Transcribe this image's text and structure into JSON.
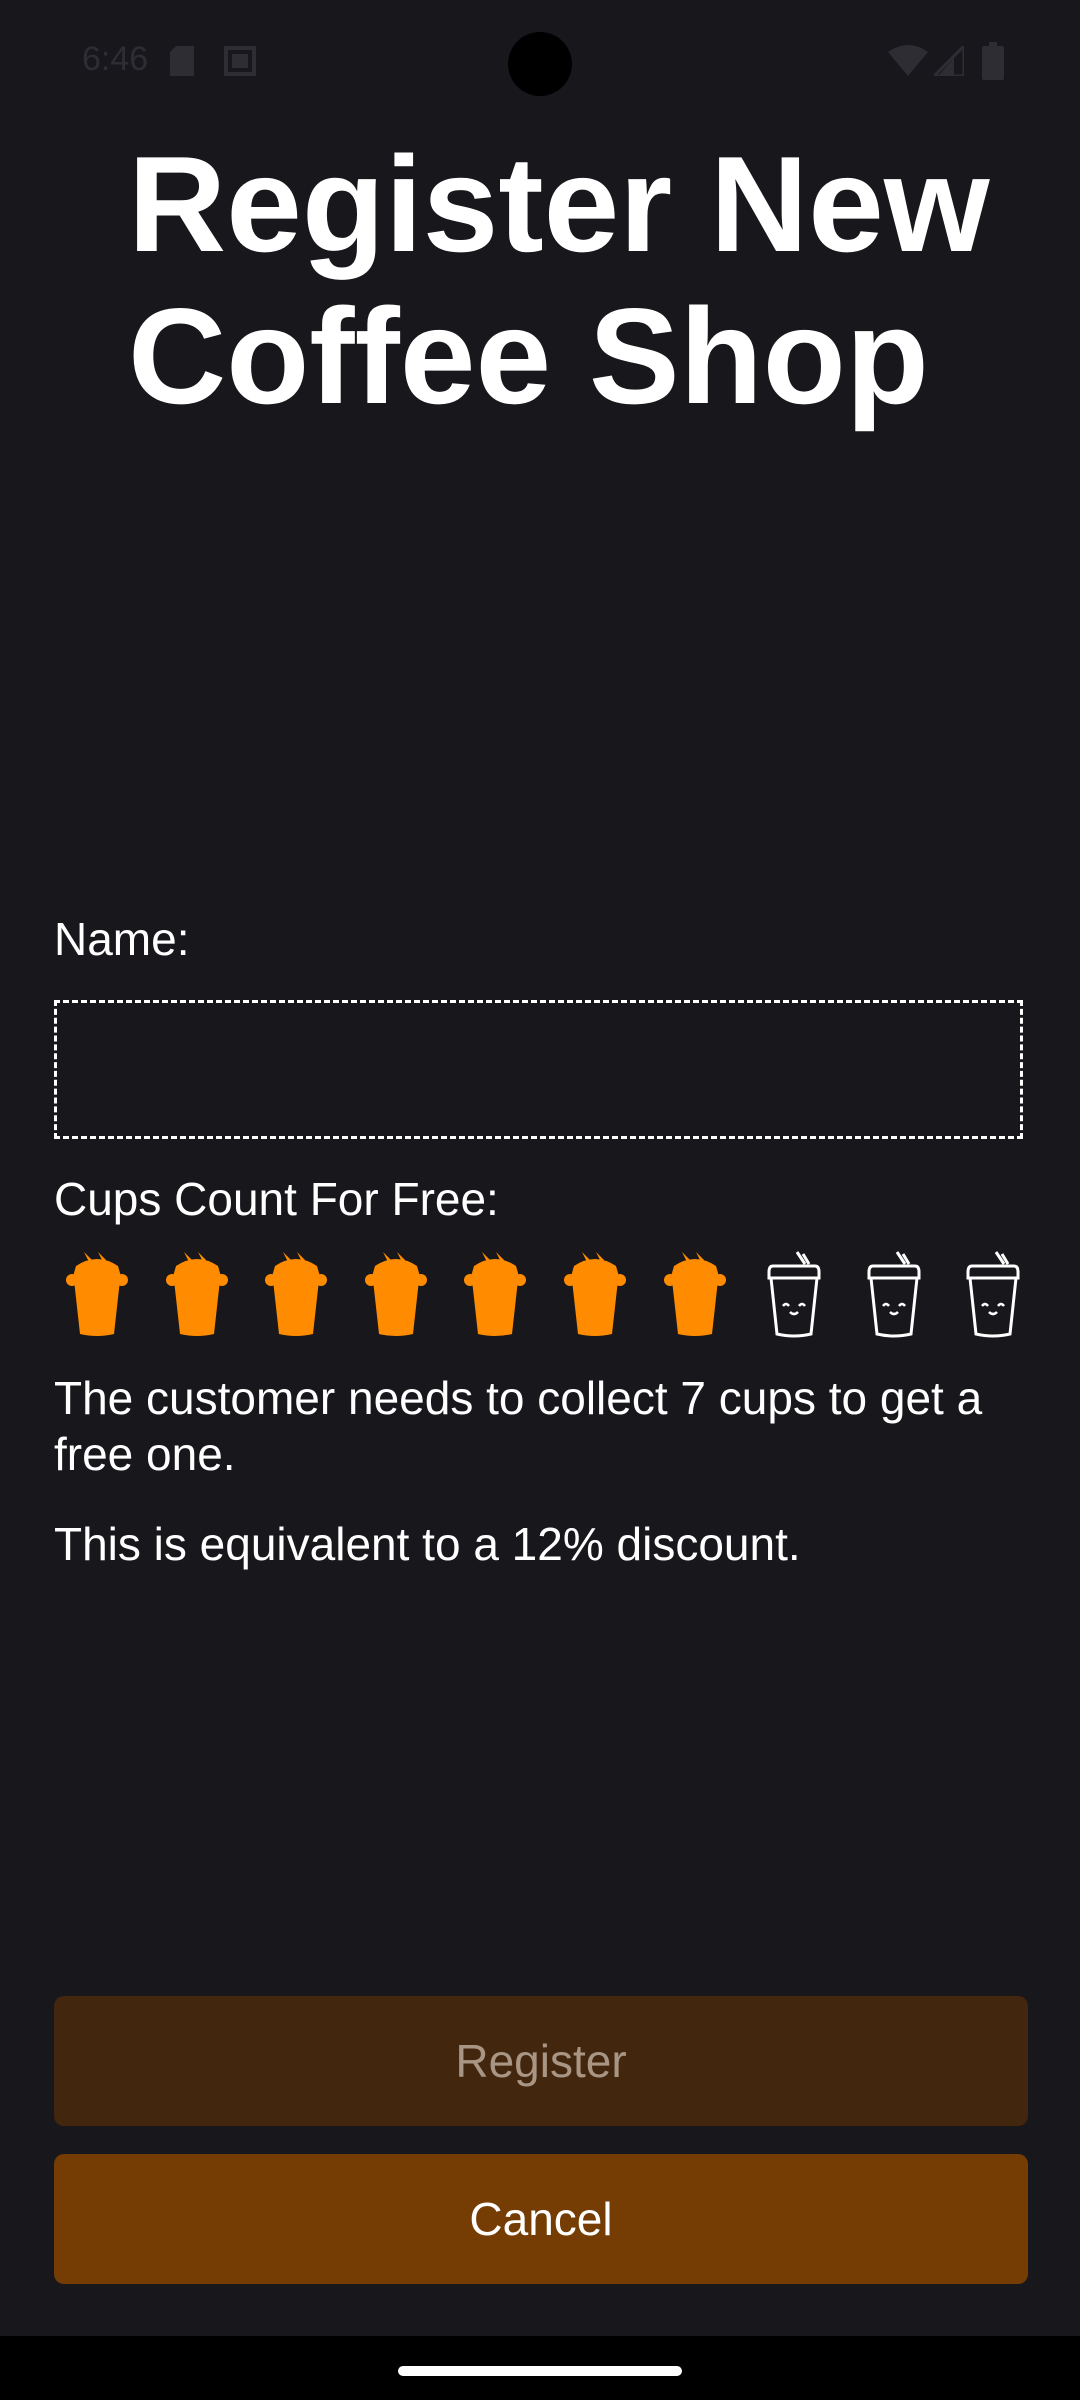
{
  "status_bar": {
    "time": "6:46",
    "left_icons": [
      "sd-card-icon",
      "screenshot-icon"
    ],
    "right_icons": [
      "wifi-icon",
      "signal-icon",
      "battery-icon"
    ]
  },
  "title": "Register New\nCoffee Shop",
  "form": {
    "name_label": "Name:",
    "name_value": "",
    "cups_label": "Cups Count For Free:",
    "cups_selected": 7,
    "cups_total": 10,
    "selected_color": "#ff8c00",
    "unselected_color": "#ffffff"
  },
  "info": {
    "collect_text": "The customer needs to collect 7 cups to get a free one.",
    "discount_text": "This is equivalent to a 12% discount."
  },
  "buttons": {
    "register_label": "Register",
    "cancel_label": "Cancel"
  },
  "colors": {
    "background": "#18171c",
    "register_bg": "#43260e",
    "cancel_bg": "#753c03"
  }
}
